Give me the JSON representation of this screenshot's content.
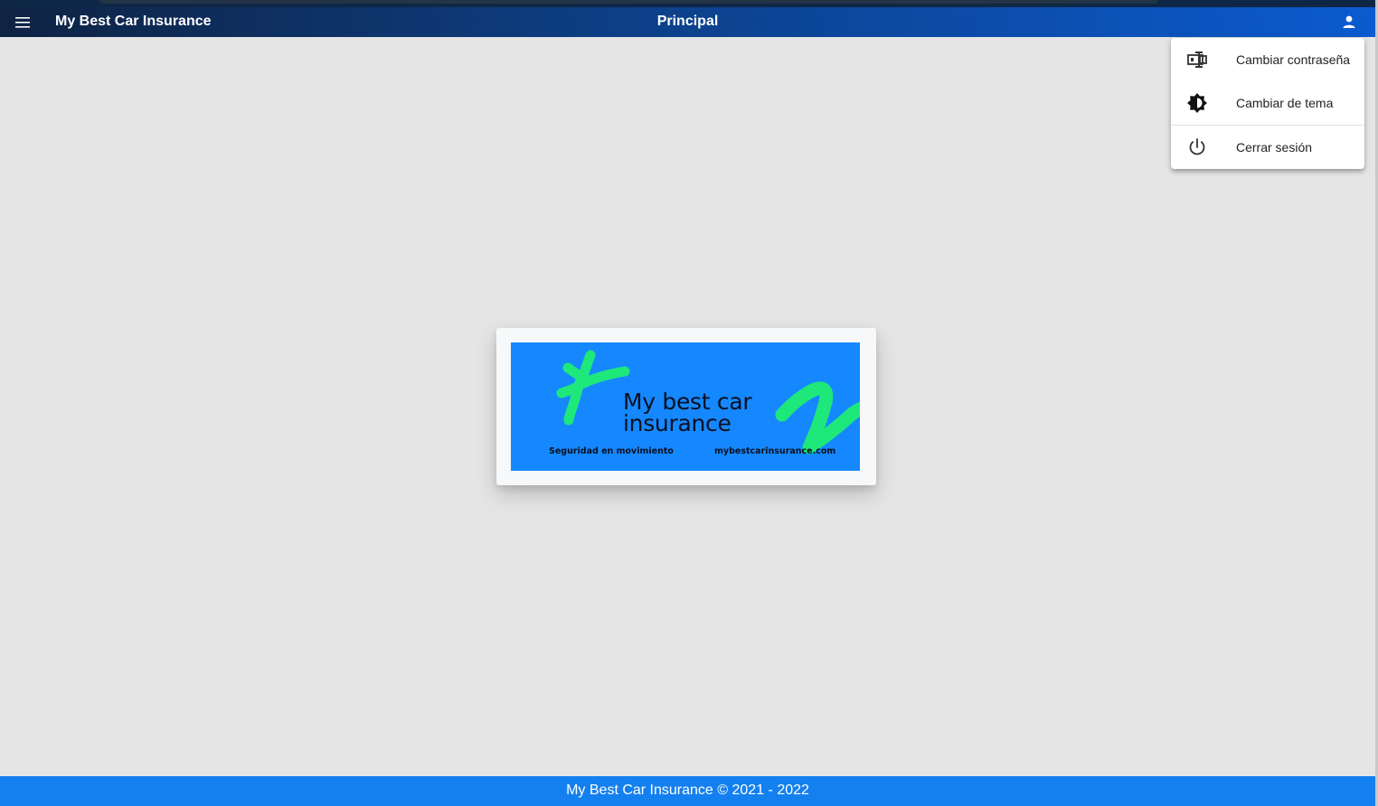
{
  "toolbar": {
    "menu_icon": "hamburger-menu-icon",
    "app_title": "My Best Car Insurance",
    "page_title": "Principal",
    "user_icon": "account-icon"
  },
  "user_menu": {
    "items": [
      {
        "label": "Cambiar contraseña",
        "icon": "password-field-icon"
      },
      {
        "label": "Cambiar de tema",
        "icon": "brightness-icon"
      },
      {
        "label": "Cerrar sesión",
        "icon": "power-icon"
      }
    ]
  },
  "logo": {
    "brand_line1": "My best car",
    "brand_line2": "insurance",
    "tagline": "Seguridad en movimiento",
    "website": "mybestcarinsurance.com",
    "colors": {
      "background": "#1588ff",
      "accent": "#1ee87a",
      "text": "#0a0f1e"
    }
  },
  "footer": {
    "text": "My Best Car Insurance © 2021 - 2022"
  },
  "colors": {
    "toolbar_start": "#0f2343",
    "toolbar_end": "#0b5bd0",
    "footer": "#1480f0",
    "page_background": "#e5e5e5"
  }
}
